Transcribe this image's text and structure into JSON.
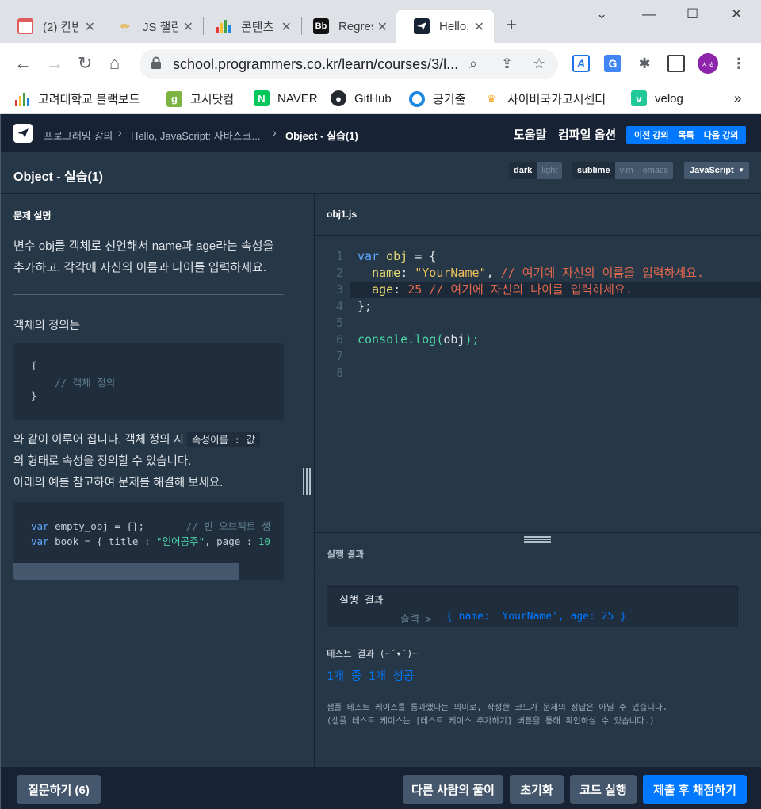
{
  "browser": {
    "tabs": [
      {
        "title": "(2) 칸반",
        "favicon": "calendar-icon"
      },
      {
        "title": "JS 챌린지",
        "favicon": "pencil-icon"
      },
      {
        "title": "콘텐츠",
        "favicon": "bar-chart-icon"
      },
      {
        "title": "Regression",
        "favicon": "bb-icon"
      },
      {
        "title": "Hello, JavaScript",
        "favicon": "programmers-icon"
      }
    ],
    "url": "school.programmers.co.kr/learn/courses/3/l...",
    "profile_initials": "ㅅㅎ",
    "bookmarks": [
      {
        "label": "고려대학교 블랙보드",
        "icon": "bar-chart-icon"
      },
      {
        "label": "고시닷컴",
        "icon": "g-icon"
      },
      {
        "label": "NAVER",
        "icon": "naver-icon"
      },
      {
        "label": "GitHub",
        "icon": "github-icon"
      },
      {
        "label": "공기출",
        "icon": "circle-icon"
      },
      {
        "label": "사이버국가고시센터",
        "icon": "crown-icon"
      },
      {
        "label": "velog",
        "icon": "velog-icon"
      }
    ],
    "more_bookmarks": "»"
  },
  "site": {
    "breadcrumb": [
      "프로그래밍 강의",
      "Hello, JavaScript: 자바스크...",
      "Object - 실습(1)"
    ],
    "help": "도움말",
    "compile_options": "컴파일 옵션",
    "prev_lesson": "이전 강의",
    "list": "목록",
    "next_lesson": "다음 강의"
  },
  "titlebar": {
    "title": "Object - 실습(1)",
    "theme": {
      "dark": "dark",
      "light": "light"
    },
    "keymap": {
      "sublime": "sublime",
      "vim": "vim",
      "emacs": "emacs"
    },
    "language": "JavaScript"
  },
  "problem": {
    "heading": "문제 설명",
    "intro": "변수 obj를 객체로 선언해서 name과 age라는 속성을 추가하고, 각각에 자신의 이름과 나이를 입력하세요.",
    "def_title": "객체의 정의는",
    "def_code": [
      "{",
      "    // 객체 정의",
      "}"
    ],
    "text1": "와 같이 이루어 집니다. 객체 정의 시",
    "inline_code": "속성이름 : 값",
    "text2": "의 형태로 속성을 정의할 수 있습니다.",
    "text3": "아래의 예를 참고하여 문제를 해결해 보세요.",
    "example": {
      "line1_kw": "var",
      "line1_rest": " empty_obj = {};",
      "line1_cmt": "// 빈 오브젝트 생",
      "line2_kw": "var",
      "line2_rest": " book = { title : ",
      "line2_str": "\"인어공주\"",
      "line2_tail": ", page : ",
      "line2_num": "10"
    }
  },
  "editor": {
    "filename": "obj1.js",
    "line_numbers": [
      "1",
      "2",
      "3",
      "4",
      "5",
      "6",
      "7",
      "8"
    ],
    "code": {
      "l1_var": "var",
      "l1_name": "obj",
      "l1_rest": " = {",
      "l2_key": "name",
      "l2_colon": ": ",
      "l2_val": "\"YourName\"",
      "l2_comma": ", ",
      "l2_cmt": "// 여기에 자신의 이름을 입력하세요.",
      "l3_key": "age",
      "l3_colon": ": ",
      "l3_val": "25",
      "l3_cmt": " // 여기에 자신의 나이를 입력하세요.",
      "l4": "};",
      "l6_fn": "console",
      "l6_rest": ".log(",
      "l6_arg": "obj",
      "l6_end": ");"
    }
  },
  "results": {
    "panel_label": "실행 결과",
    "box_title": "실행 결과",
    "output_label": "출력 >",
    "output_value": "{ name: 'YourName', age: 25 }",
    "test_heading": "테스트 결과 (~˘▾˘)~",
    "test_result": "1개 중 1개 성공",
    "note_line1": "샘플 테스트 케이스를 통과했다는 의미로, 작성한 코드가 문제의 정답은 아닐 수 있습니다.",
    "note_line2": "(샘플 테스트 케이스는 [테스트 케이스 추가하기] 버튼을 통해 확인하실 수 있습니다.)"
  },
  "footer": {
    "ask": "질문하기 (6)",
    "others": "다른 사람의 풀이",
    "reset": "초기화",
    "run": "코드 실행",
    "submit": "제출 후 채점하기"
  }
}
